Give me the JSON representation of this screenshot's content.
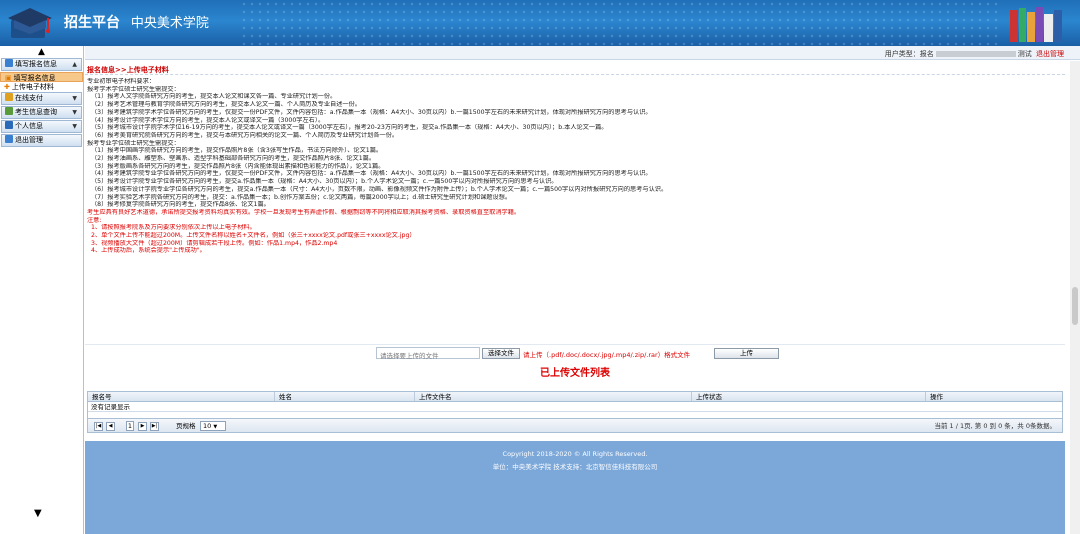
{
  "header": {
    "title": "招生平台",
    "subtitle": "中央美术学院"
  },
  "userbar": {
    "label": "用户类型：报名",
    "suffix": "测试",
    "logout": "退出管理"
  },
  "sidebar": {
    "menus": [
      {
        "label": "填写报名信息",
        "icon": "edit-icon",
        "items": [
          "填写报名信息",
          "上传电子材料"
        ]
      },
      {
        "label": "在线支付",
        "icon": "payment-icon",
        "items": []
      },
      {
        "label": "考生信息查询",
        "icon": "search-icon",
        "items": []
      },
      {
        "label": "个人信息",
        "icon": "user-icon",
        "items": []
      },
      {
        "label": "退出管理",
        "icon": "logout-icon",
        "items": []
      }
    ]
  },
  "breadcrumb": "报名信息>>上传电子材料",
  "content": {
    "intro": "专业初审电子材料要求：",
    "section1_title": "报考学术学位硕士研究生需提交：",
    "section1": [
      "（1）报考人文学院各研究方向的考生，提交本人论文和课文各一篇、专业研究计划一份。",
      "（2）报考艺术管理与教育学院各研究方向的考生，提交本人论文一篇、个人简历及专业自述一份。",
      "（3）报考建筑学院学术学位各研究方向的考生，仅提交一份PDF文件，文件内容包括：a.作品集一本（规格：A4大小、30页以内）b.一篇1500字左右的未来研究计划，体现对所报研究方向的思考与认识。",
      "（4）报考设计学院学术学位方向的考生，提交本人论文或译文一篇（3000字左右）。",
      "（5）报考城市设计学院学术学位16-19方向的考生，提交本人论文或译文一篇（3000字左右），报考20-23方向的考生，提交a.作品集一本（规格：A4大小、30页以内）；b.本人论文一篇。",
      "（6）报考美育研究院各研究方向的考生，提交与本研究方向相关的论文一篇、个人简历及专业研究计划各一份。"
    ],
    "section2_title": "报考专业学位硕士研究生需提交：",
    "section2": [
      "（1）报考中国画学院各研究方向的考生，提交作品照片8张（含3张写生作品，书法方向除外）、论文1篇。",
      "（2）报考油画系、雕塑系、壁画系、造型学科基础部各研究方向的考生，提交作品照片8张、论文1篇。",
      "（3）报考版画系各研究方向的考生，提交作品照片8张（内含能体现出素描和色彩能力的作品），论文1篇。",
      "（4）报考建筑学院专业学位各研究方向的考生，仅提交一份PDF文件，文件内容包括：a.作品集一本（规格：A4大小、30页以内）b.一篇1500字左右的未来研究计划，体现对所报研究方向的思考与认识。",
      "（5）报考设计学院专业学位各研究方向的考生，提交a.作品集一本（规格：A4大小、30页以内）；b.个人学术论文一篇；c.一篇500字以内对所报研究方向的思考与认识。",
      "（6）报考城市设计学院专业学位各研究方向的考生，提交a.作品集一本（尺寸：A4大小，页数不限，动画、影像视频文件作为附件上传）；b.个人学术论文一篇；c.一篇500字以内对所报研究方向的思考与认识。",
      "（7）报考实验艺术学院各研究方向的考生，提交：a.作品集一本；b.创作方案五份；c.论文两篇，每篇2000字以上；d.硕士研究生研究计划和课题设想。",
      "（8）报考修复学院各研究方向的考生，提交作品8张、论文1篇。"
    ],
    "warning": "考生应具有良好艺术道德，承诺所提交报考资料均真实有效。学校一旦发现考生有弄虚作假、根据剽窃等不同将相应取消其报考资格、录取资格直至取消学籍。",
    "notice_title": "注意:",
    "notices": [
      "1、请按照报考院系及方向要求分别依次上传以上电子材料。",
      "2、单个文件上传不能超过200M。上传文件名称以姓名+文件名，例如（张三+xxxx论文.pdf或张三+xxxx论文.jpg）",
      "3、视频播放大文件（超过200M）请剪辑成若干段上传。例如：作品1.mp4，作品2.mp4",
      "4、上传成功后，系统会提示\"上传成功\"。"
    ]
  },
  "upload": {
    "placeholder": "请选择要上传的文件",
    "choose": "选择文件",
    "hint": "请上传（.pdf/.doc/.docx/.jpg/.mp4/.zip/.rar）格式文件",
    "submit": "上传"
  },
  "list": {
    "title": "已上传文件列表",
    "columns": [
      "报名号",
      "姓名",
      "上传文件名",
      "上传状态",
      "操作"
    ],
    "empty": "没有记录显示",
    "pager": {
      "page": "1",
      "page_size_label": "页规格",
      "page_size": "10",
      "info": "当前 1 / 1页, 第 0 到 0 条，共 0条数据。"
    }
  },
  "footer": {
    "copyright": "Copyright 2018-2020 © All Rights Reserved.",
    "credits": "单位：中央美术学院   技术支持：北京智信佳科技有限公司"
  }
}
